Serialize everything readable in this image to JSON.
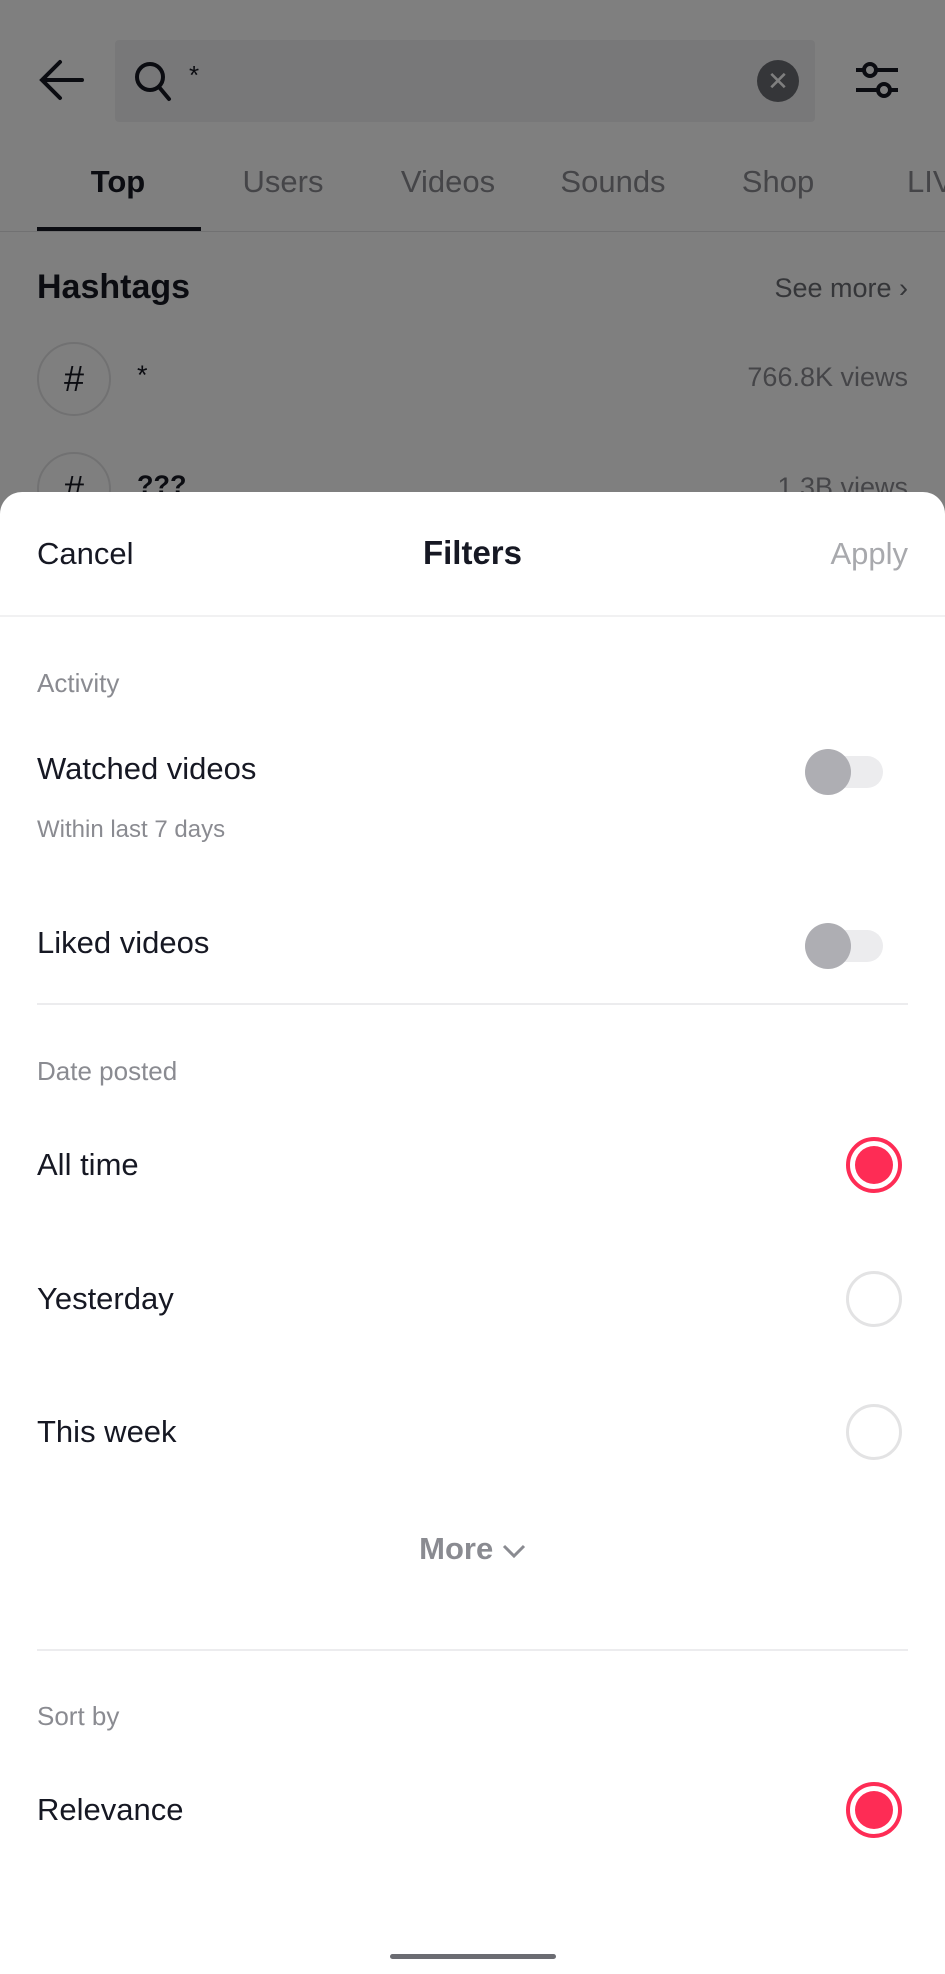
{
  "search": {
    "query": "*"
  },
  "tabs": [
    "Top",
    "Users",
    "Videos",
    "Sounds",
    "Shop",
    "LIV"
  ],
  "hashtags": {
    "title": "Hashtags",
    "see_more": "See more",
    "items": [
      {
        "name": "*",
        "views": "766.8K views"
      },
      {
        "name": "???",
        "views": "1.3B views"
      }
    ]
  },
  "filters": {
    "cancel": "Cancel",
    "title": "Filters",
    "apply": "Apply",
    "activity": {
      "label": "Activity",
      "watched": "Watched videos",
      "watched_sub": "Within last 7 days",
      "watched_on": false,
      "liked": "Liked videos",
      "liked_on": false
    },
    "date": {
      "label": "Date posted",
      "options": [
        "All time",
        "Yesterday",
        "This week"
      ],
      "selected": "All time",
      "more": "More"
    },
    "sort": {
      "label": "Sort by",
      "options": [
        "Relevance"
      ],
      "selected": "Relevance"
    }
  },
  "colors": {
    "accent": "#fe2c55"
  }
}
